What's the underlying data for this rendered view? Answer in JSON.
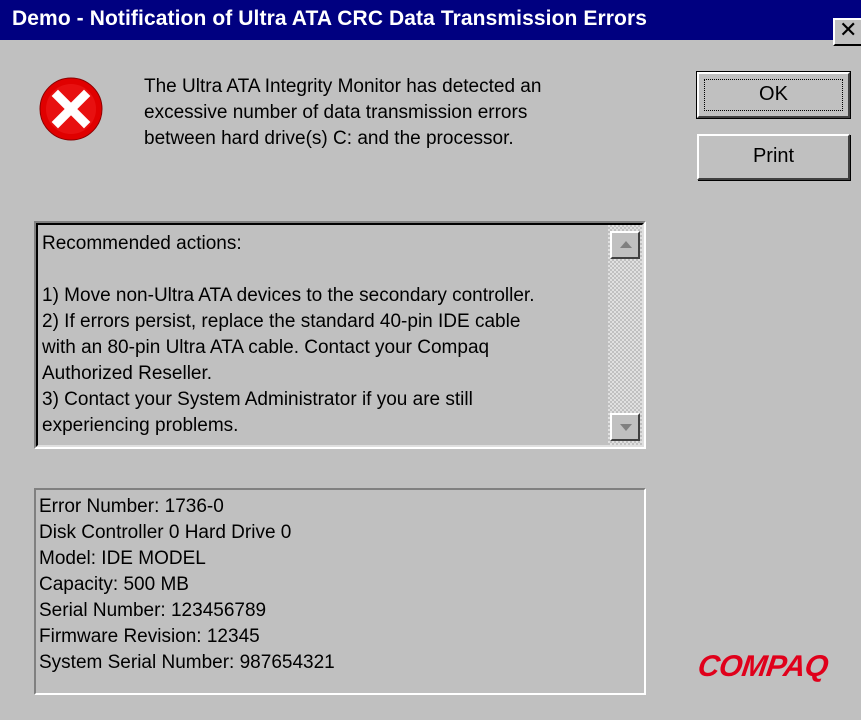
{
  "window": {
    "title": "Demo - Notification of Ultra ATA CRC Data Transmission Errors",
    "close_symbol": "✕"
  },
  "icon": {
    "name": "error-icon",
    "color": "#e00000"
  },
  "message": "The Ultra ATA Integrity Monitor has detected an\nexcessive number of data transmission errors\nbetween hard drive(s) C: and the processor.",
  "buttons": {
    "ok_label": "OK",
    "print_label": "Print"
  },
  "actions": {
    "heading": "Recommended actions:",
    "lines": [
      "1) Move non-Ultra ATA devices to the secondary controller.",
      "2) If errors persist, replace the standard 40-pin IDE cable",
      "with an 80-pin Ultra ATA cable.  Contact your Compaq",
      "Authorized Reseller.",
      "3) Contact your System Administrator if you are still",
      "experiencing problems."
    ]
  },
  "details": {
    "lines": [
      "Error Number: 1736-0",
      "Disk Controller 0 Hard Drive 0",
      "Model: IDE MODEL",
      "Capacity: 500 MB",
      "Serial Number: 123456789",
      "Firmware Revision: 12345",
      "System Serial Number: 987654321"
    ]
  },
  "logo": {
    "text": "COMPAQ",
    "color": "#e0001b"
  }
}
